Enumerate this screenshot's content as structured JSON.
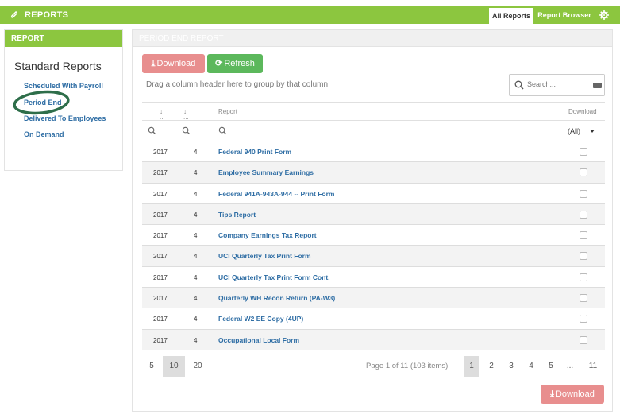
{
  "topbar": {
    "title": "REPORTS",
    "tabs": [
      {
        "label": "All Reports",
        "active": true
      },
      {
        "label": "Report Browser",
        "active": false
      }
    ],
    "accent": "#8cc63f"
  },
  "left": {
    "header": "REPORT",
    "title": "Standard Reports",
    "links": [
      "Scheduled With Payroll",
      "Period End",
      "Delivered To Employees",
      "On Demand"
    ]
  },
  "main": {
    "header": "PERIOD END REPORT",
    "download_label": "Download",
    "refresh_label": "Refresh",
    "group_hint": "Drag a column header here to group by that column",
    "search_placeholder": "Search...",
    "columns": {
      "year": "...",
      "period": "...",
      "report": "Report",
      "download": "Download"
    },
    "download_filter": "(All)",
    "rows": [
      {
        "year": "2017",
        "period": "4",
        "report": "Federal 940 Print Form"
      },
      {
        "year": "2017",
        "period": "4",
        "report": "Employee Summary Earnings"
      },
      {
        "year": "2017",
        "period": "4",
        "report": "Federal 941A-943A-944 -- Print Form"
      },
      {
        "year": "2017",
        "period": "4",
        "report": "Tips Report"
      },
      {
        "year": "2017",
        "period": "4",
        "report": "Company Earnings Tax Report"
      },
      {
        "year": "2017",
        "period": "4",
        "report": "UCI Quarterly Tax Print Form"
      },
      {
        "year": "2017",
        "period": "4",
        "report": "UCI Quarterly Tax Print Form Cont."
      },
      {
        "year": "2017",
        "period": "4",
        "report": "Quarterly WH Recon Return (PA-W3)"
      },
      {
        "year": "2017",
        "period": "4",
        "report": "Federal W2 EE Copy (4UP)"
      },
      {
        "year": "2017",
        "period": "4",
        "report": "Occupational Local Form"
      }
    ],
    "page_sizes": [
      "5",
      "10",
      "20"
    ],
    "page_info": "Page 1 of 11 (103 items)",
    "pages": [
      "1",
      "2",
      "3",
      "4",
      "5",
      "...",
      "11"
    ],
    "bottom_download_label": "Download"
  }
}
